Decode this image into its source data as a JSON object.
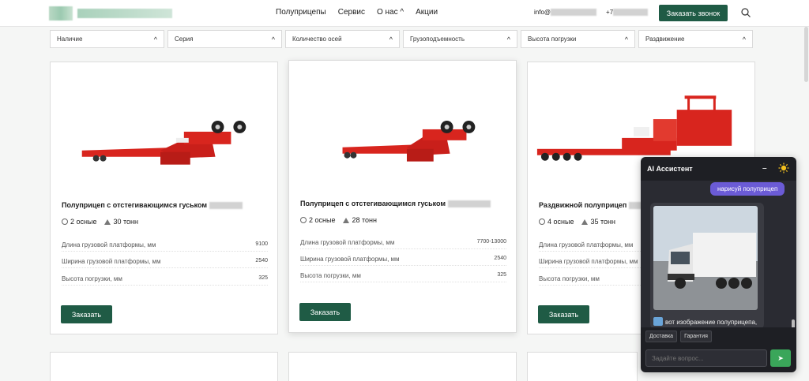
{
  "header": {
    "nav": [
      "Полуприцепы",
      "Сервис",
      "О нас",
      "Акции"
    ],
    "about_chevron": "^",
    "email_prefix": "info@",
    "phone_prefix": "+7",
    "call_button": "Заказать звонок"
  },
  "filters": [
    {
      "label": "Наличие"
    },
    {
      "label": "Серия"
    },
    {
      "label": "Количество осей"
    },
    {
      "label": "Грузоподъемность"
    },
    {
      "label": "Высота погрузки"
    },
    {
      "label": "Раздвижение"
    }
  ],
  "cards": [
    {
      "title": "Полуприцеп с отстегивающимся гуськом",
      "axles": "2 осные",
      "capacity": "30 тонн",
      "params": [
        {
          "label": "Длина грузовой платформы, мм",
          "value": "9100"
        },
        {
          "label": "Ширина грузовой платформы, мм",
          "value": "2540"
        },
        {
          "label": "Высота погрузки, мм",
          "value": "325"
        }
      ],
      "order": "Заказать"
    },
    {
      "title": "Полуприцеп с отстегивающимся гуськом",
      "axles": "2 осные",
      "capacity": "28 тонн",
      "params": [
        {
          "label": "Длина грузовой платформы, мм",
          "value": "7700-13000"
        },
        {
          "label": "Ширина грузовой платформы, мм",
          "value": "2540"
        },
        {
          "label": "Высота погрузки, мм",
          "value": "325"
        }
      ],
      "order": "Заказать"
    },
    {
      "title": "Раздвижной полуприцеп",
      "axles": "4 осные",
      "capacity": "35 тонн",
      "params": [
        {
          "label": "Длина грузовой платформы, мм",
          "value": ""
        },
        {
          "label": "Ширина грузовой платформы, мм",
          "value": ""
        },
        {
          "label": "Высота погрузки, мм",
          "value": ""
        }
      ],
      "order": "Заказать"
    }
  ],
  "chat": {
    "title": "AI Ассистент",
    "minimize": "–",
    "user_message": "нарисуй полуприцеп",
    "bot_message": "вот изображение полуприцепа, которое я",
    "chips": [
      "Доставка",
      "Гарантия"
    ],
    "input_placeholder": "Задайте вопрос...",
    "send": "➤"
  },
  "colors": {
    "brand_green": "#1f5b45",
    "chat_bg": "#1e1f24",
    "user_bubble": "#6b5bd6",
    "send_green": "#3aa65a",
    "trailer_red": "#d8251e"
  }
}
